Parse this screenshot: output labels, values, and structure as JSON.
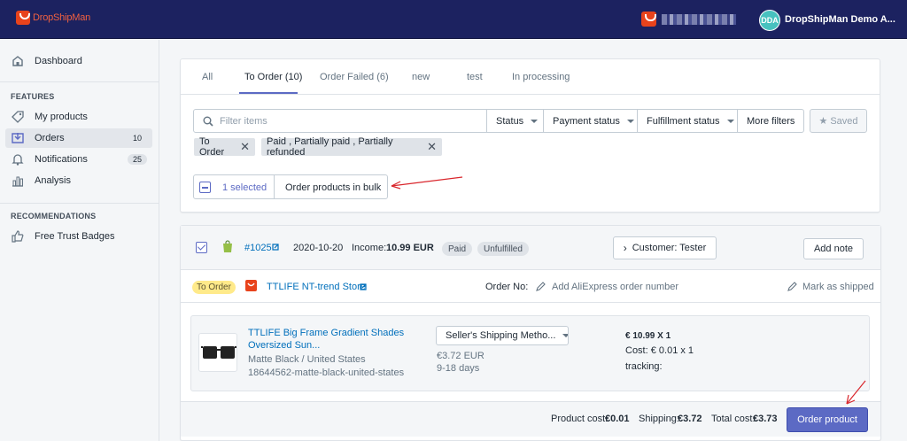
{
  "topbar": {
    "logo_text": "DropShipMan",
    "account_initials": "DDA",
    "account_name": "DropShipMan Demo A..."
  },
  "sidebar": {
    "dashboard": "Dashboard",
    "features_heading": "FEATURES",
    "items": [
      {
        "label": "My products",
        "badge": ""
      },
      {
        "label": "Orders",
        "badge": "10"
      },
      {
        "label": "Notifications",
        "badge": "25"
      },
      {
        "label": "Analysis",
        "badge": ""
      }
    ],
    "recommendations_heading": "RECOMMENDATIONS",
    "trust_badges": "Free Trust Badges"
  },
  "tabs": [
    "All",
    "To Order (10)",
    "Order Failed (6)",
    "new",
    "test",
    "In processing"
  ],
  "filters": {
    "search_placeholder": "Filter items",
    "status": "Status",
    "payment_status": "Payment status",
    "fulfillment_status": "Fulfillment status",
    "more_filters": "More filters",
    "saved": "Saved",
    "chips": [
      "To Order",
      "Paid , Partially paid , Partially refunded"
    ]
  },
  "bulk": {
    "selected": "1 selected",
    "action": "Order products in bulk"
  },
  "order": {
    "number": "#1025",
    "date": "2020-10-20",
    "income_label": "Income:",
    "income_value": "10.99 EUR",
    "paid_badge": "Paid",
    "fulfill_badge": "Unfulfilled",
    "customer": "Customer: Tester",
    "add_note": "Add note",
    "to_order_badge": "To Order",
    "store_name": "TTLIFE NT-trend Store",
    "order_no_label": "Order No:",
    "aliexpress_placeholder": "Add AliExpress order number",
    "mark_shipped": "Mark as shipped",
    "product": {
      "title_line1": "TTLIFE Big Frame Gradient Shades",
      "title_line2": "Oversized Sun...",
      "variant": "Matte Black / United States",
      "sku": "18644562-matte-black-united-states",
      "shipping_method": "Seller's Shipping Metho...",
      "shipping_cost": "€3.72 EUR",
      "shipping_days": "9-18 days",
      "price_qty": "€ 10.99 X 1",
      "cost": "Cost: € 0.01 x 1",
      "tracking": "tracking:"
    },
    "product_cost_label": "Product cost:",
    "product_cost": "€0.01",
    "shipping_label": "Shipping:",
    "shipping": "€3.72",
    "total_label": "Total cost:",
    "total": "€3.73",
    "order_button": "Order product"
  },
  "colors": {
    "topbar": "#1c2260",
    "accent": "#5c6ac4",
    "link": "#006fbb",
    "annotation": "#d9262c"
  }
}
